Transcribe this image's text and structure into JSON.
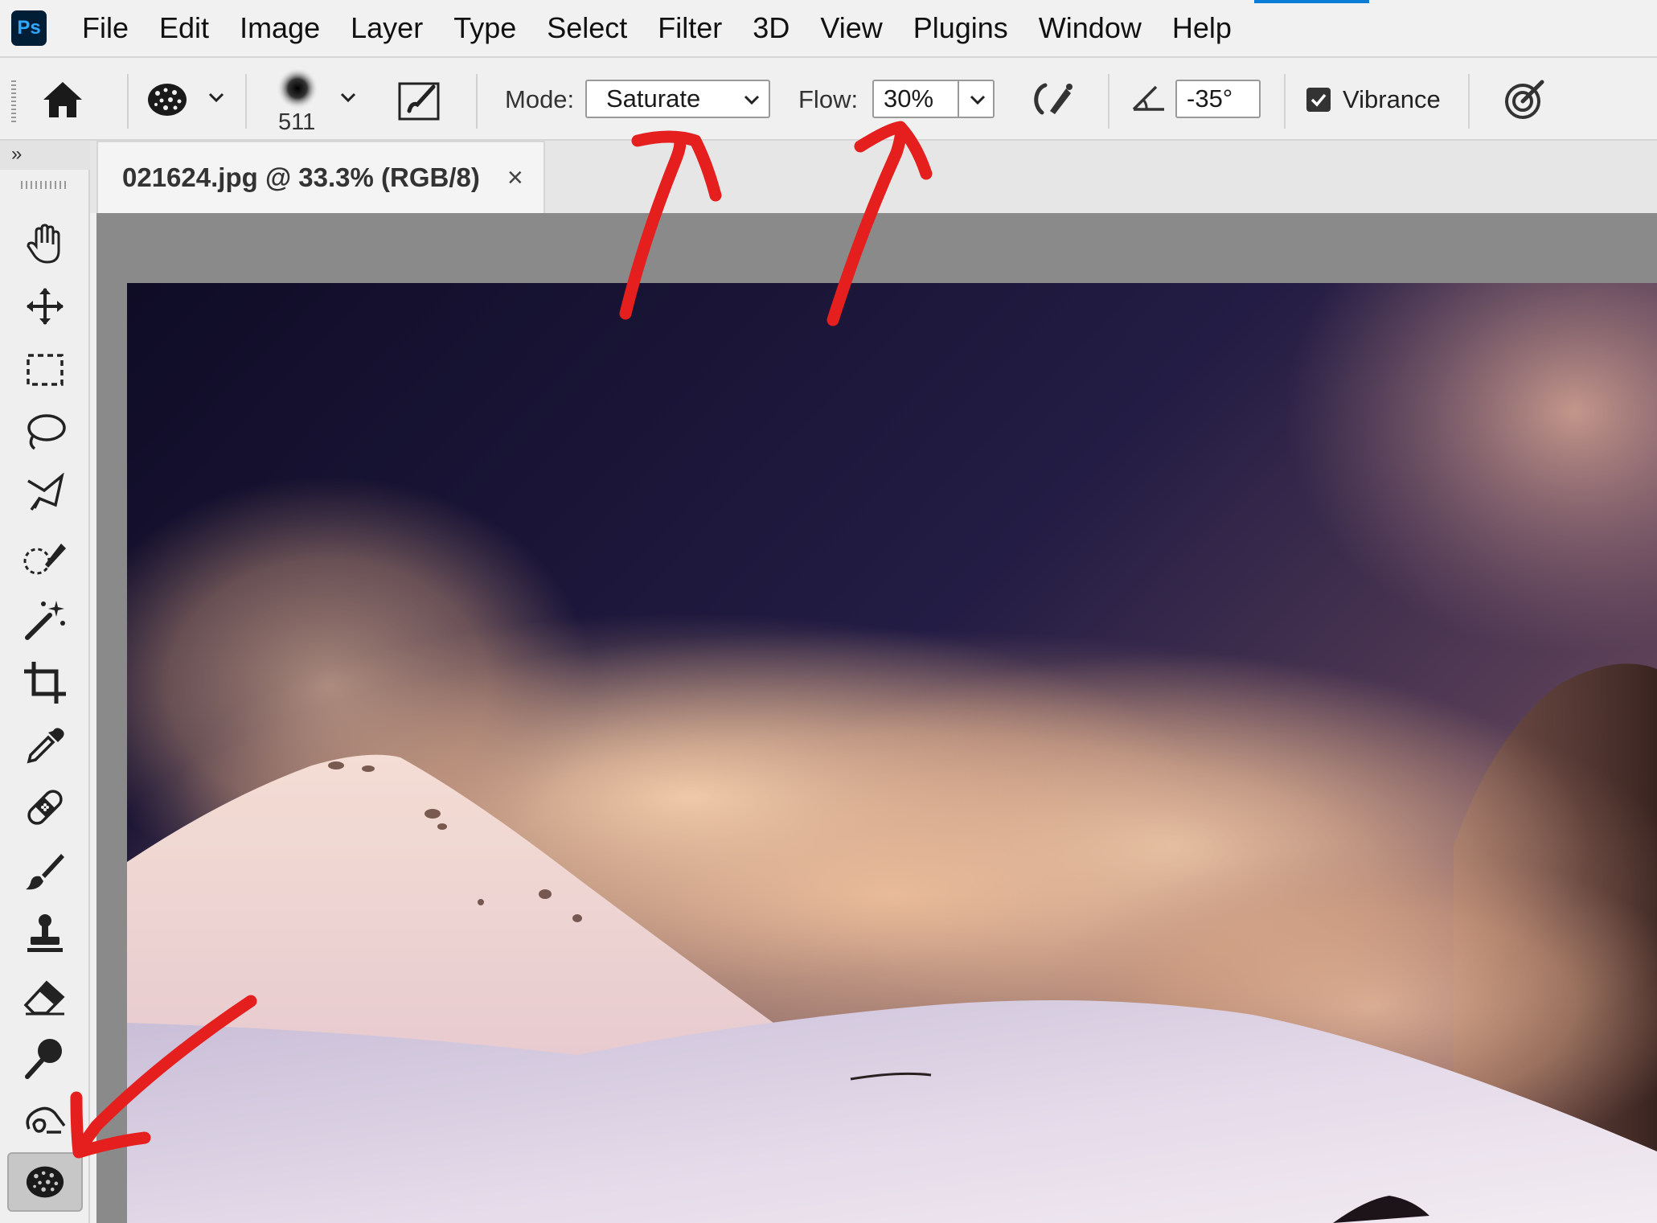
{
  "app": {
    "logo_text": "Ps"
  },
  "menu": [
    "File",
    "Edit",
    "Image",
    "Layer",
    "Type",
    "Select",
    "Filter",
    "3D",
    "View",
    "Plugins",
    "Window",
    "Help"
  ],
  "options_bar": {
    "home_icon": "home-icon",
    "tool_preset_icon": "sponge-icon",
    "brush_size": "511",
    "brush_settings_icon": "brush-settings-icon",
    "mode_label": "Mode:",
    "mode_value": "Saturate",
    "flow_label": "Flow:",
    "flow_value": "30%",
    "airbrush_icon": "airbrush-icon",
    "angle_icon": "angle-icon",
    "angle_value": "-35°",
    "vibrance_label": "Vibrance",
    "vibrance_checked": true,
    "pressure_icon": "pressure-icon"
  },
  "toolbar": {
    "collapse_label": "»",
    "tools": [
      "hand-icon",
      "move-icon",
      "rectangular-marquee-icon",
      "lasso-icon",
      "polygonal-lasso-icon",
      "quick-selection-icon",
      "magic-wand-icon",
      "crop-icon",
      "eyedropper-icon",
      "healing-brush-icon",
      "brush-icon",
      "clone-stamp-icon",
      "eraser-icon",
      "dodge-icon",
      "smudge-icon",
      "sponge-icon"
    ],
    "active_tool": "sponge-icon"
  },
  "document": {
    "tab_title": "021624.jpg @ 33.3% (RGB/8)",
    "close_glyph": "×"
  },
  "colors": {
    "accent": "#0a7cd6",
    "annotation": "#e51e1e",
    "ps_logo_bg": "#001e36",
    "ps_logo_text": "#31a8ff"
  }
}
